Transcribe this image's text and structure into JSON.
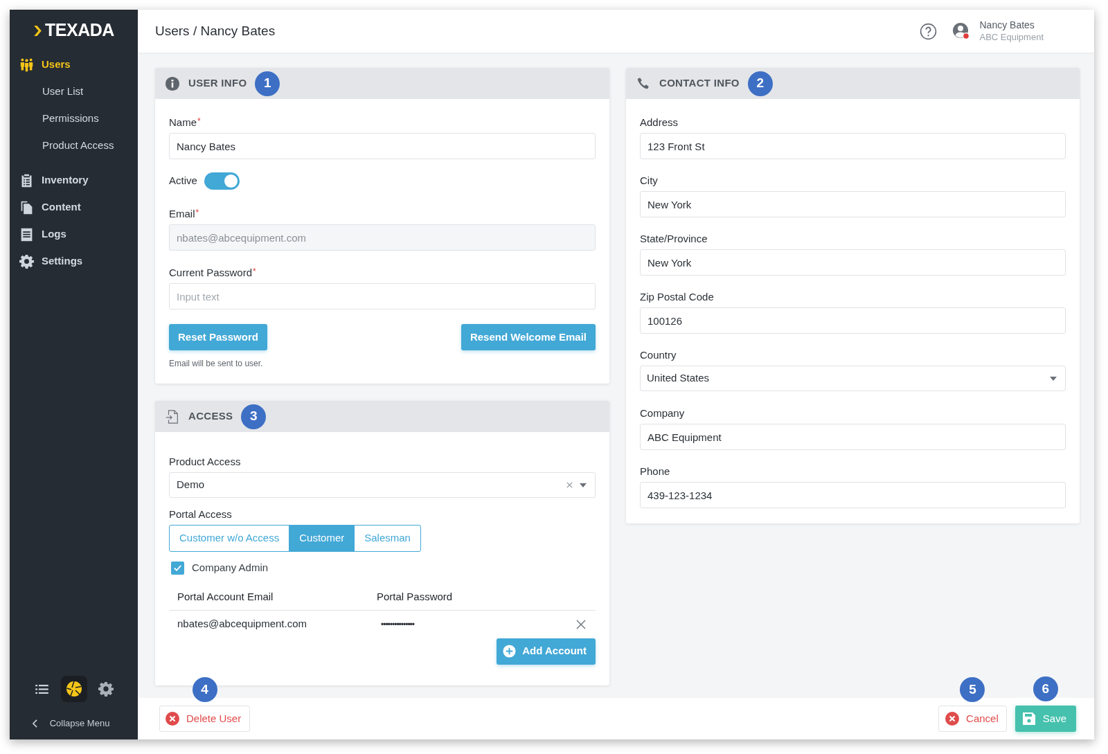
{
  "sidebar": {
    "logo": "TEXADA",
    "nav": [
      {
        "label": "Users",
        "selected": true,
        "children": [
          {
            "label": "User List"
          },
          {
            "label": "Permissions"
          },
          {
            "label": "Product Access"
          }
        ]
      },
      {
        "label": "Inventory",
        "selected": false
      },
      {
        "label": "Content",
        "selected": false
      },
      {
        "label": "Logs",
        "selected": false
      },
      {
        "label": "Settings",
        "selected": false
      }
    ],
    "collapse_label": "Collapse Menu"
  },
  "header": {
    "breadcrumb": "Users / Nancy Bates",
    "user": {
      "name": "Nancy Bates",
      "company": "ABC Equipment"
    }
  },
  "user_info": {
    "title": "USER INFO",
    "callout": "1",
    "name": {
      "label": "Name",
      "required_mark": "*",
      "value": "Nancy Bates"
    },
    "active": {
      "label": "Active",
      "on": true
    },
    "email": {
      "label": "Email",
      "required_mark": "*",
      "value": "nbates@abcequipment.com",
      "disabled": true
    },
    "current_password": {
      "label": "Current Password",
      "required_mark": "*",
      "placeholder": "Input text"
    },
    "buttons": [
      "Reset Password",
      "Resend Welcome Email"
    ],
    "note": "Email will be sent to user."
  },
  "access": {
    "title": "ACCESS",
    "callout": "3",
    "product_access": {
      "label": "Product Access",
      "value": "Demo"
    },
    "portal_access": {
      "label": "Portal Access",
      "options": [
        {
          "label": "Customer w/o Access",
          "selected": false
        },
        {
          "label": "Customer",
          "selected": true
        },
        {
          "label": "Salesman",
          "selected": false
        }
      ]
    },
    "company_admin": {
      "label": "Company Admin",
      "checked": true
    },
    "accounts": {
      "columns": [
        "Portal Account Email",
        "Portal Password"
      ],
      "rows": [
        {
          "email": "nbates@abcequipment.com",
          "password": "•••••••••••••••"
        }
      ]
    },
    "add_button": "Add Account"
  },
  "contact_info": {
    "title": "CONTACT INFO",
    "callout": "2",
    "fields": [
      {
        "kind": "text",
        "label": "Address",
        "value": "123 Front St"
      },
      {
        "kind": "text",
        "label": "City",
        "value": "New York"
      },
      {
        "kind": "text",
        "label": "State/Province",
        "value": "New York"
      },
      {
        "kind": "text",
        "label": "Zip Postal Code",
        "value": "100126"
      },
      {
        "kind": "select",
        "label": "Country",
        "value": "United States"
      },
      {
        "kind": "text",
        "label": "Company",
        "value": "ABC Equipment"
      },
      {
        "kind": "text",
        "label": "Phone",
        "value": "439-123-1234"
      }
    ]
  },
  "footer": {
    "delete": {
      "label": "Delete User",
      "callout": "4"
    },
    "cancel": {
      "label": "Cancel",
      "callout": "5"
    },
    "save": {
      "label": "Save",
      "callout": "6"
    }
  }
}
